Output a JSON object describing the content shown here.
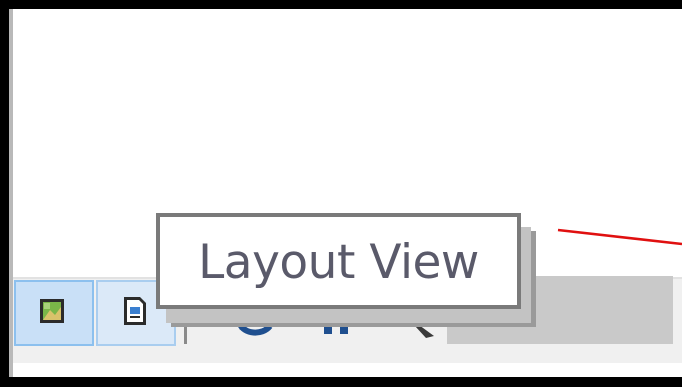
{
  "tooltip": {
    "text": "Layout View"
  },
  "view_buttons": [
    {
      "icon": "data-view-icon"
    },
    {
      "icon": "layout-view-icon"
    }
  ],
  "tools": [
    {
      "icon": "refresh-icon"
    },
    {
      "icon": "pause-icon"
    },
    {
      "icon": "pointer-icon"
    }
  ],
  "colors": {
    "tooltip_border": "#7a7a7a",
    "tooltip_text": "#5a5a6a",
    "annotation_line": "#e01010",
    "active_button_bg": "#c9e0f7"
  }
}
